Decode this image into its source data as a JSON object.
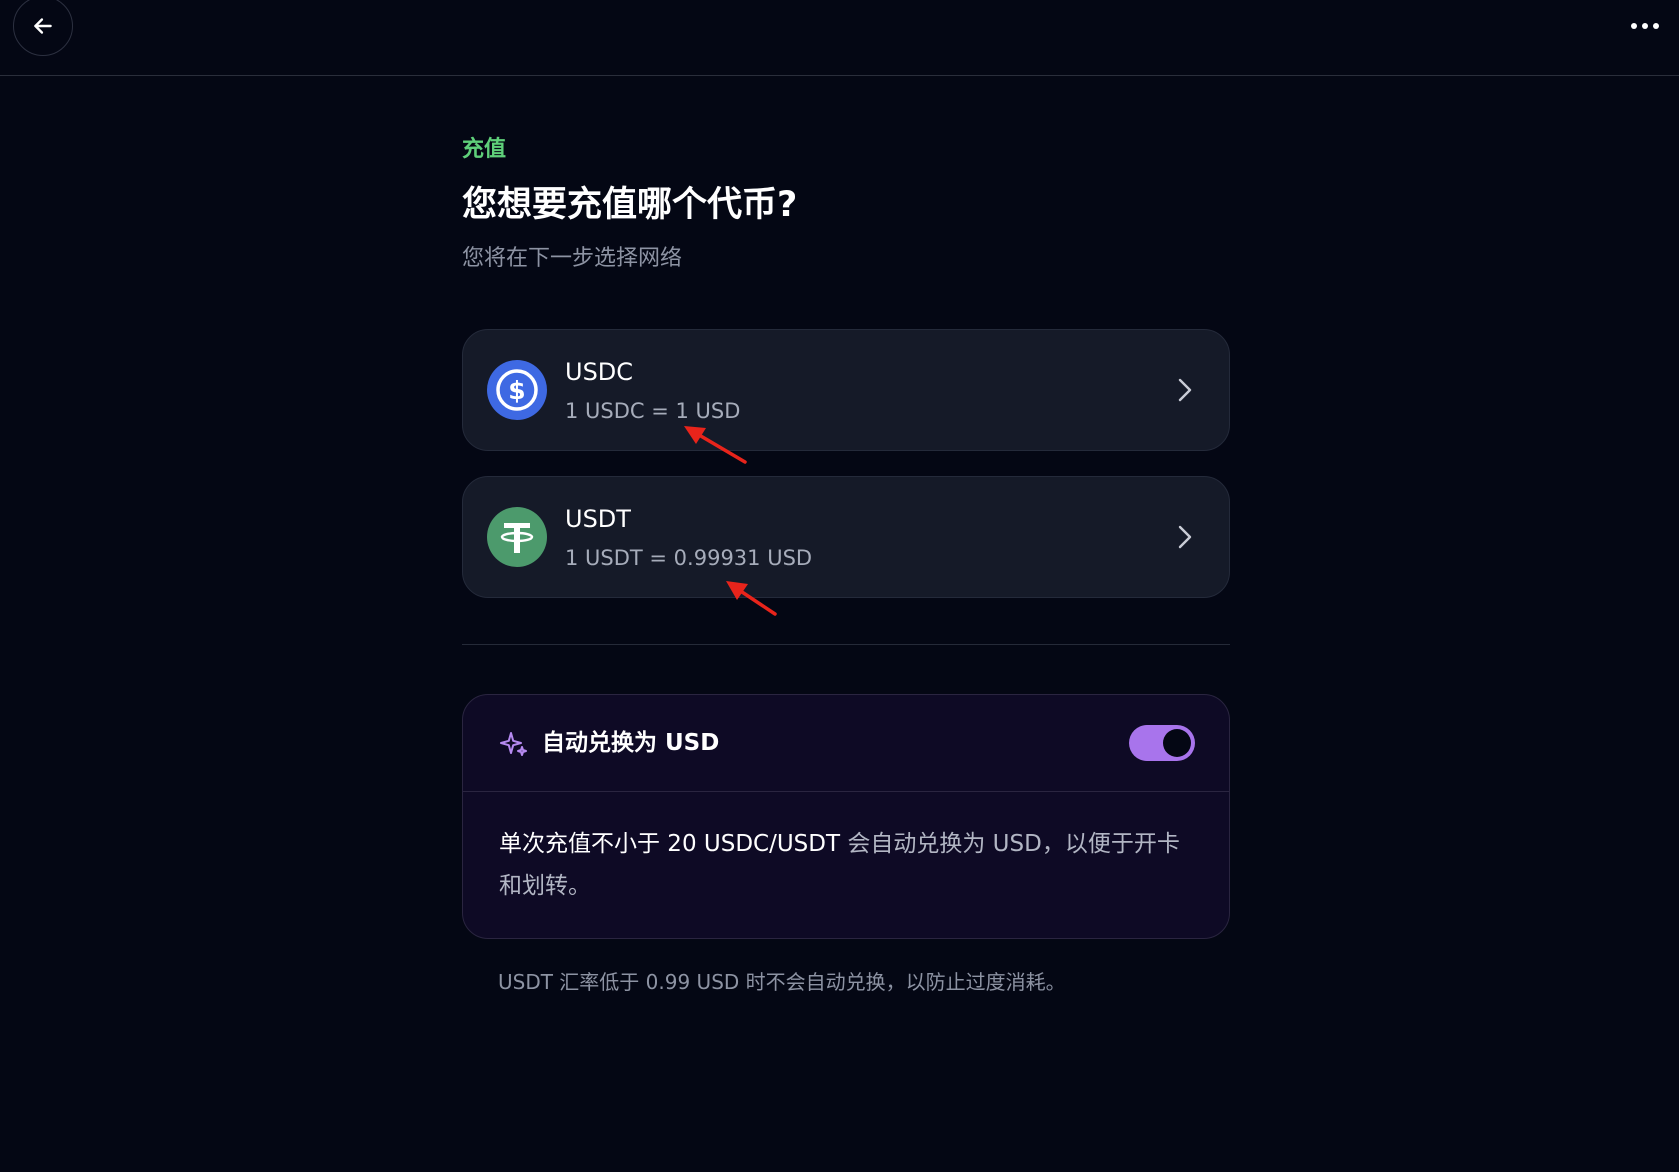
{
  "header": {
    "back_icon": "arrow-left-icon",
    "more_icon": "more-horizontal-icon"
  },
  "page": {
    "eyebrow": "充值",
    "title": "您想要充值哪个代币?",
    "subtitle": "您将在下一步选择网络"
  },
  "tokens": [
    {
      "name": "USDC",
      "rate": "1 USDC = 1 USD",
      "icon": "usdc-icon",
      "color": "#3e69e3"
    },
    {
      "name": "USDT",
      "rate": "1 USDT = 0.99931 USD",
      "icon": "usdt-icon",
      "color": "#4c9a6c"
    }
  ],
  "auto_convert": {
    "icon": "sparkle-icon",
    "title": "自动兑换为 USD",
    "enabled": true,
    "desc_strong": "单次充值不小于 20 USDC/USDT",
    "desc_rest": " 会自动兑换为 USD，以便于开卡和划转。",
    "note": "USDT 汇率低于 0.99 USD 时不会自动兑换，以防止过度消耗。"
  },
  "colors": {
    "background": "#040714",
    "accent_green": "#5fd07a",
    "toggle_on": "#a874ec",
    "annotation_red": "#e8241b"
  }
}
